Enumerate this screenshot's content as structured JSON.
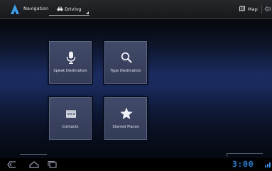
{
  "action_bar": {
    "app_icon": "navigation-arrow-icon",
    "title": "Navigation",
    "mode": {
      "icon": "car-icon",
      "label": "Driving"
    },
    "map_action": {
      "icon": "map-icon",
      "label": "Map"
    },
    "overflow_icon": "overflow-icon"
  },
  "tiles": [
    {
      "id": "speak",
      "label": "Speak Destination",
      "icon": "microphone-icon"
    },
    {
      "id": "type",
      "label": "Type Destination",
      "icon": "search-icon"
    },
    {
      "id": "contacts",
      "label": "Contacts",
      "icon": "contacts-icon"
    },
    {
      "id": "starred",
      "label": "Starred Places",
      "icon": "star-icon"
    }
  ],
  "system_bar": {
    "back_icon": "back-icon",
    "home_icon": "home-icon",
    "recent_icon": "recent-apps-icon",
    "clock": "3:00",
    "accent_color": "#3d8fe0"
  },
  "colors": {
    "accent": "#3ea0e8",
    "tile_background": "#3a4260",
    "tile_border": "#5b6584",
    "background_center": "#1a2b5f"
  }
}
